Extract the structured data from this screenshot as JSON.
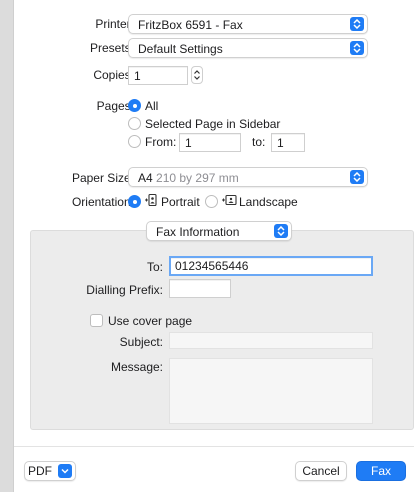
{
  "printer": {
    "label": "Printer:",
    "value": "FritzBox 6591 - Fax"
  },
  "presets": {
    "label": "Presets:",
    "value": "Default Settings"
  },
  "copies": {
    "label": "Copies:",
    "value": "1"
  },
  "pages": {
    "label": "Pages:",
    "all": "All",
    "selected_page": "Selected Page in Sidebar",
    "from_label": "From:",
    "from_value": "1",
    "to_label": "to:",
    "to_value": "1"
  },
  "paper_size": {
    "label": "Paper Size:",
    "size": "A4",
    "dims": "210 by 297 mm"
  },
  "orientation": {
    "label": "Orientation:",
    "portrait": "Portrait",
    "landscape": "Landscape"
  },
  "section_popup": {
    "value": "Fax Information"
  },
  "fax": {
    "to_label": "To:",
    "to_value": "01234565446",
    "prefix_label": "Dialling Prefix:",
    "prefix_value": "",
    "cover_page_label": "Use cover page",
    "subject_label": "Subject:",
    "message_label": "Message:"
  },
  "footer": {
    "pdf_label": "PDF",
    "cancel_label": "Cancel",
    "fax_label": "Fax"
  },
  "colors": {
    "accent": "#1f7cf5",
    "panel": "#ececec",
    "sidebar": "#dcdcdc"
  },
  "icons": {
    "popup": "up-down-chevron-icon",
    "portrait": "portrait-orientation-icon",
    "landscape": "landscape-orientation-icon",
    "pdf": "chevron-down-icon"
  }
}
